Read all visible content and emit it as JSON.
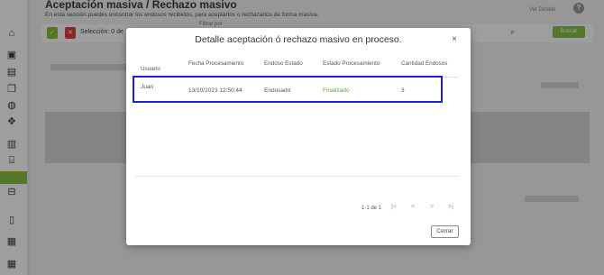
{
  "page": {
    "title": "Aceptación masiva / Rechazo masivo",
    "subtitle": "En esta sección puedes encontrar los endosos recibidos, para aceptarlos o rechazarlos de forma masiva.",
    "details_link": "Ver Detalle",
    "help_icon": "?"
  },
  "toolbar": {
    "selection_label": "Selección: 0 de",
    "filter_label": "Filtrar por",
    "search_button": "Buscar"
  },
  "sidebar": {
    "icons": [
      "home-icon",
      "briefcase-icon",
      "store-icon",
      "copy-icon",
      "globe-icon",
      "move-icon",
      "clipboard-icon",
      "bank-icon",
      "active-item",
      "inbox-icon",
      "document-icon",
      "chart-icon",
      "chart-icon"
    ]
  },
  "modal": {
    "title": "Detalle aceptación ó rechazo masivo en proceso.",
    "close_label": "×",
    "columns": {
      "usuario": "Usuario",
      "fecha": "Fecha Procesamiento",
      "endoso": "Endoso Estado",
      "estado": "Estado Procesamiento",
      "cantidad": "Cantidad Endosos"
    },
    "rows": [
      {
        "usuario": "Juan",
        "fecha": "13/10/2023 12:50:44",
        "endoso": "Endosado",
        "estado": "Finalizado",
        "cantidad": "3"
      }
    ],
    "pagination": {
      "range": "1-1 de 1",
      "first": "|<",
      "prev": "<",
      "next": ">",
      "last": ">|"
    },
    "close_button": "Cerrar"
  },
  "colors": {
    "accent_green": "#86c340",
    "danger_red": "#d9443c",
    "status_finalizado": "#6aa42f",
    "row_highlight": "#1c1fd0"
  }
}
